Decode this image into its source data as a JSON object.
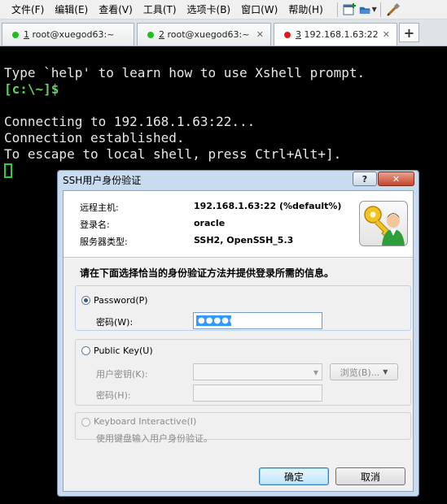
{
  "menu": {
    "items": [
      "文件(F)",
      "编辑(E)",
      "查看(V)",
      "工具(T)",
      "选项卡(B)",
      "窗口(W)",
      "帮助(H)"
    ]
  },
  "toolbar": {
    "icons": [
      "new-session-icon",
      "open-folder-icon",
      "properties-icon"
    ]
  },
  "tabs": [
    {
      "num": "1",
      "label": " root@xuegod63:~",
      "status_color": "#1fbf1f",
      "active": false
    },
    {
      "num": "2",
      "label": " root@xuegod63:~",
      "status_color": "#1fbf1f",
      "active": false
    },
    {
      "num": "3",
      "label": " 192.168.1.63:22",
      "status_color": "#e11b1b",
      "active": true
    }
  ],
  "tab_add_label": "+",
  "terminal": {
    "lines": [
      "Type `help' to learn how to use Xshell prompt.",
      "[c:\\~]$",
      "",
      "Connecting to 192.168.1.63:22...",
      "Connection established.",
      "To escape to local shell, press Ctrl+Alt+]."
    ]
  },
  "dialog": {
    "title": "SSH用户身份验证",
    "help_label": "?",
    "close_label": "✕",
    "info": {
      "host_label": "远程主机:",
      "host_value": "192.168.1.63:22 (%default%)",
      "user_label": "登录名:",
      "user_value": "oracle",
      "server_label": "服务器类型:",
      "server_value": "SSH2, OpenSSH_5.3"
    },
    "instruction": "请在下面选择恰当的身份验证方法并提供登录所需的信息。",
    "password": {
      "radio_label": "Password(P)",
      "field_label": "密码(W):",
      "value_mask": "●●●●●●",
      "selected": true
    },
    "public_key": {
      "radio_label": "Public Key(U)",
      "key_label": "用户密钥(K):",
      "key_value": "",
      "browse_label": "浏览(B)...",
      "passphrase_label": "密码(H):",
      "selected": false
    },
    "keyboard_interactive": {
      "radio_label": "Keyboard Interactive(I)",
      "description": "使用键盘输入用户身份验证。",
      "enabled": false
    },
    "ok_label": "确定",
    "cancel_label": "取消"
  }
}
